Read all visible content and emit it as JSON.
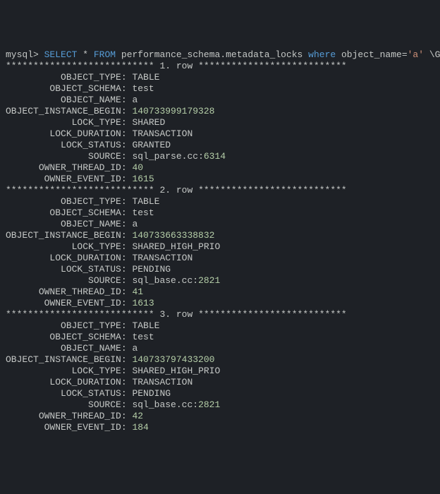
{
  "query": {
    "prompt": "mysql>",
    "kw_select": "SELECT",
    "star": "*",
    "kw_from": "FROM",
    "table": "performance_schema.metadata_locks",
    "kw_where": "where",
    "cond_field": "object_name=",
    "cond_value": "'a'",
    "tail": "\\G"
  },
  "row_stars_left": "***************************",
  "row_stars_right": "***************************",
  "row_label": "row",
  "labels": {
    "OBJECT_TYPE": "OBJECT_TYPE",
    "OBJECT_SCHEMA": "OBJECT_SCHEMA",
    "OBJECT_NAME": "OBJECT_NAME",
    "OBJECT_INSTANCE_BEGIN": "OBJECT_INSTANCE_BEGIN",
    "LOCK_TYPE": "LOCK_TYPE",
    "LOCK_DURATION": "LOCK_DURATION",
    "LOCK_STATUS": "LOCK_STATUS",
    "SOURCE": "SOURCE",
    "OWNER_THREAD_ID": "OWNER_THREAD_ID",
    "OWNER_EVENT_ID": "OWNER_EVENT_ID"
  },
  "rows": [
    {
      "n": "1.",
      "OBJECT_TYPE": "TABLE",
      "OBJECT_SCHEMA": "test",
      "OBJECT_NAME": "a",
      "OBJECT_INSTANCE_BEGIN": "140733999179328",
      "LOCK_TYPE": "SHARED",
      "LOCK_DURATION": "TRANSACTION",
      "LOCK_STATUS": "GRANTED",
      "SOURCE_FILE": "sql_parse.cc:",
      "SOURCE_LINE": "6314",
      "OWNER_THREAD_ID": "40",
      "OWNER_EVENT_ID": "1615"
    },
    {
      "n": "2.",
      "OBJECT_TYPE": "TABLE",
      "OBJECT_SCHEMA": "test",
      "OBJECT_NAME": "a",
      "OBJECT_INSTANCE_BEGIN": "140733663338832",
      "LOCK_TYPE": "SHARED_HIGH_PRIO",
      "LOCK_DURATION": "TRANSACTION",
      "LOCK_STATUS": "PENDING",
      "SOURCE_FILE": "sql_base.cc:",
      "SOURCE_LINE": "2821",
      "OWNER_THREAD_ID": "41",
      "OWNER_EVENT_ID": "1613"
    },
    {
      "n": "3.",
      "OBJECT_TYPE": "TABLE",
      "OBJECT_SCHEMA": "test",
      "OBJECT_NAME": "a",
      "OBJECT_INSTANCE_BEGIN": "140733797433200",
      "LOCK_TYPE": "SHARED_HIGH_PRIO",
      "LOCK_DURATION": "TRANSACTION",
      "LOCK_STATUS": "PENDING",
      "SOURCE_FILE": "sql_base.cc:",
      "SOURCE_LINE": "2821",
      "OWNER_THREAD_ID": "42",
      "OWNER_EVENT_ID": "184"
    }
  ]
}
